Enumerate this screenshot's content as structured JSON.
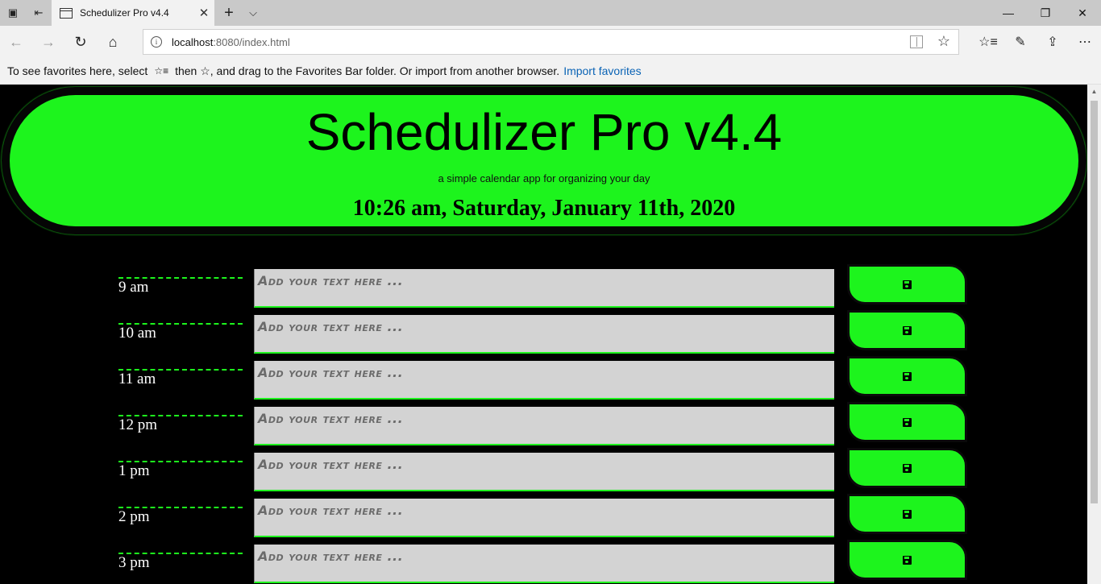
{
  "browser": {
    "tab_title": "Schedulizer Pro v4.4",
    "tab_close": "✕",
    "new_tab": "+",
    "tab_list": "⌵",
    "address_host": "localhost",
    "address_path": ":8080/index.html",
    "favorites_bar_text_1": "To see favorites here, select",
    "favorites_bar_text_2": "then ☆, and drag to the Favorites Bar folder. Or import from another browser.",
    "import_favorites": "Import favorites",
    "window_minimize": "—",
    "window_restore": "❐",
    "window_close": "✕",
    "nav_back": "←",
    "nav_forward": "→",
    "nav_refresh": "↻",
    "nav_home": "⌂",
    "favorite_star": "☆",
    "tool_favorites": "☆≡",
    "tool_notes": "✎",
    "tool_share": "⇪",
    "tool_more": "⋯",
    "info_icon": "i",
    "fav_bar_icon": "☆≡"
  },
  "header": {
    "title": "Schedulizer Pro v4.4",
    "subtitle": "a simple calendar app for organizing your day",
    "current_datetime": "10:26 am, Saturday, January 11th, 2020"
  },
  "schedule": {
    "placeholder": "Add your text here ...",
    "hours": [
      {
        "label": "9 am"
      },
      {
        "label": "10 am"
      },
      {
        "label": "11 am"
      },
      {
        "label": "12 pm"
      },
      {
        "label": "1 pm"
      },
      {
        "label": "2 pm"
      },
      {
        "label": "3 pm"
      }
    ]
  },
  "icons": {
    "save": "floppy-disk-icon"
  },
  "colors": {
    "accent": "#1df41d",
    "background": "#000000",
    "textarea": "#d3d3d3"
  }
}
